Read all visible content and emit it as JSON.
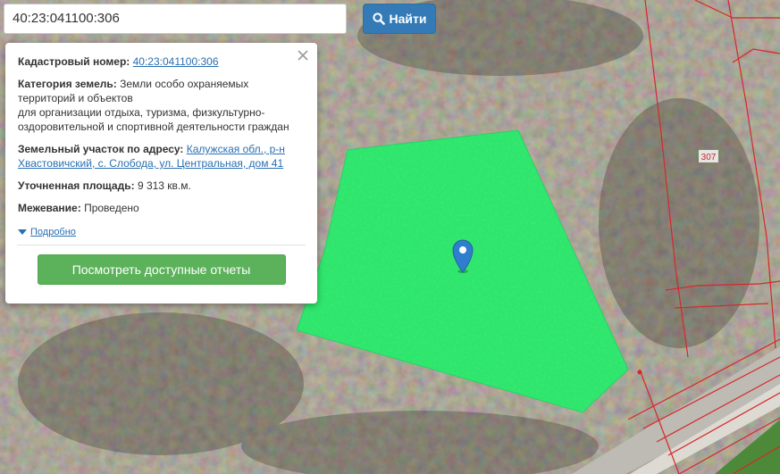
{
  "search": {
    "value": "40:23:041100:306",
    "button_label": "Найти",
    "button_icon": "search-icon"
  },
  "popup": {
    "cadastral": {
      "label": "Кадастровый номер:",
      "value": "40:23:041100:306"
    },
    "category": {
      "label": "Категория земель:",
      "value_line1": "Земли особо охраняемых",
      "value_line2": "территорий и объектов",
      "value_line3": "для организации отдыха, туризма, физкультурно-",
      "value_line4": "оздоровительной и спортивной деятельности граждан"
    },
    "address": {
      "label": "Земельный участок по адресу:",
      "value_line1": "Калужская обл., р-н",
      "value_line2": "Хвастовичский, с. Слобода, ул. Центральная, дом 41"
    },
    "area": {
      "label": "Уточненная площадь:",
      "value": "9 313 кв.м."
    },
    "survey": {
      "label": "Межевание:",
      "value": "Проведено"
    },
    "details_label": "Подробно",
    "reports_button_label": "Посмотреть доступные отчеты",
    "close_icon": "close-icon"
  },
  "map": {
    "parcel_label": "307",
    "parcel_color": "#2ee66c",
    "boundary_color": "#d8262b",
    "marker_color": "#2f7fce"
  }
}
